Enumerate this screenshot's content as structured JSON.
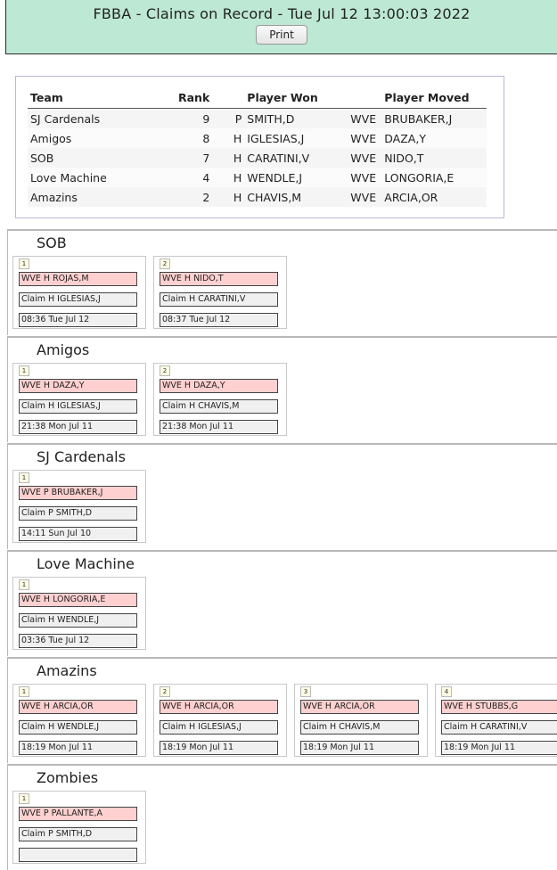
{
  "header": {
    "title": "FBBA - Claims on Record - Tue Jul 12 13:00:03 2022",
    "print_label": "Print"
  },
  "summary": {
    "columns": [
      "Team",
      "Rank",
      "",
      "Player Won",
      "",
      "Player Moved"
    ],
    "rows": [
      {
        "team": "SJ Cardenals",
        "rank": "9",
        "pos": "P",
        "won": "SMITH,D",
        "wve": "WVE",
        "moved": "BRUBAKER,J"
      },
      {
        "team": "Amigos",
        "rank": "8",
        "pos": "H",
        "won": "IGLESIAS,J",
        "wve": "WVE",
        "moved": "DAZA,Y"
      },
      {
        "team": "SOB",
        "rank": "7",
        "pos": "H",
        "won": "CARATINI,V",
        "wve": "WVE",
        "moved": "NIDO,T"
      },
      {
        "team": "Love Machine",
        "rank": "4",
        "pos": "H",
        "won": "WENDLE,J",
        "wve": "WVE",
        "moved": "LONGORIA,E"
      },
      {
        "team": "Amazins",
        "rank": "2",
        "pos": "H",
        "won": "CHAVIS,M",
        "wve": "WVE",
        "moved": "ARCIA,OR"
      }
    ]
  },
  "teams": [
    {
      "name": "SOB",
      "claims": [
        {
          "num": "1",
          "wve": "WVE H ROJAS,M",
          "claim": "Claim H IGLESIAS,J",
          "time": "08:36 Tue Jul 12"
        },
        {
          "num": "2",
          "wve": "WVE H NIDO,T",
          "claim": "Claim H CARATINI,V",
          "time": "08:37 Tue Jul 12"
        }
      ]
    },
    {
      "name": "Amigos",
      "claims": [
        {
          "num": "1",
          "wve": "WVE H DAZA,Y",
          "claim": "Claim H IGLESIAS,J",
          "time": "21:38 Mon Jul 11"
        },
        {
          "num": "2",
          "wve": "WVE H DAZA,Y",
          "claim": "Claim H CHAVIS,M",
          "time": "21:38 Mon Jul 11"
        }
      ]
    },
    {
      "name": "SJ Cardenals",
      "claims": [
        {
          "num": "1",
          "wve": "WVE P BRUBAKER,J",
          "claim": "Claim P SMITH,D",
          "time": "14:11 Sun Jul 10"
        }
      ]
    },
    {
      "name": "Love Machine",
      "claims": [
        {
          "num": "1",
          "wve": "WVE H LONGORIA,E",
          "claim": "Claim H WENDLE,J",
          "time": "03:36 Tue Jul 12"
        }
      ]
    },
    {
      "name": "Amazins",
      "claims": [
        {
          "num": "1",
          "wve": "WVE H ARCIA,OR",
          "claim": "Claim H WENDLE,J",
          "time": "18:19 Mon Jul 11"
        },
        {
          "num": "2",
          "wve": "WVE H ARCIA,OR",
          "claim": "Claim H IGLESIAS,J",
          "time": "18:19 Mon Jul 11"
        },
        {
          "num": "3",
          "wve": "WVE H ARCIA,OR",
          "claim": "Claim H CHAVIS,M",
          "time": "18:19 Mon Jul 11"
        },
        {
          "num": "4",
          "wve": "WVE H STUBBS,G",
          "claim": "Claim H CARATINI,V",
          "time": "18:19 Mon Jul 11"
        }
      ]
    },
    {
      "name": "Zombies",
      "claims": [
        {
          "num": "1",
          "wve": "WVE P PALLANTE,A",
          "claim": "Claim P SMITH,D",
          "time": ""
        }
      ]
    }
  ],
  "colors": {
    "header_bg": "#bde8d4",
    "wve_bg": "#ffd0d0",
    "claim_bg": "#f0f0f0",
    "number_bg": "#fdfbe3",
    "summary_border": "#b7b7dc"
  }
}
